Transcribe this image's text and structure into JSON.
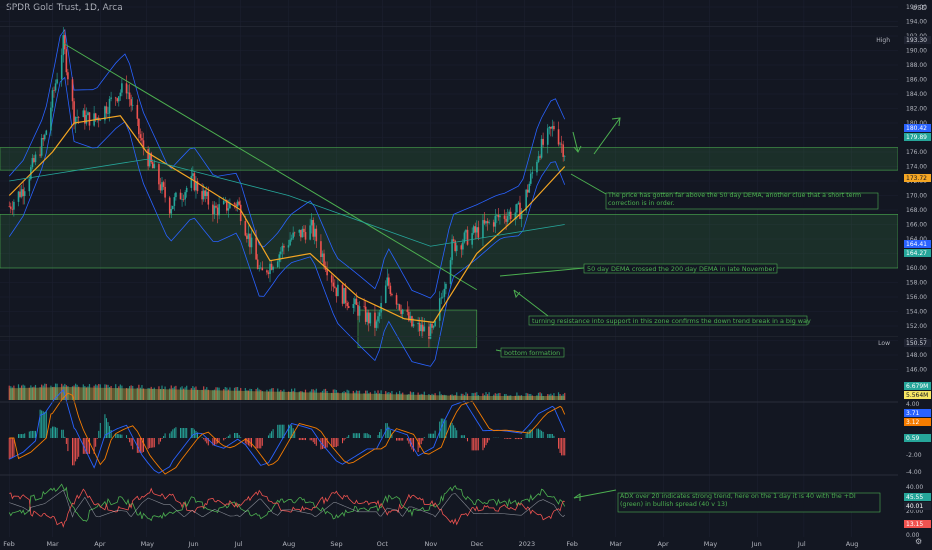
{
  "header": {
    "title": "SPDR Gold Trust, 1D, Arca"
  },
  "axis": {
    "currency": "USD",
    "price_ticks": [
      "196.00",
      "194.00",
      "192.00",
      "190.00",
      "188.00",
      "186.00",
      "184.00",
      "182.00",
      "180.00",
      "178.00",
      "176.00",
      "174.00",
      "172.00",
      "170.00",
      "168.00",
      "166.00",
      "164.00",
      "162.00",
      "160.00",
      "158.00",
      "156.00",
      "154.00",
      "152.00",
      "150.00",
      "148.00",
      "146.00"
    ],
    "macd_ticks": [
      "4.00",
      "2.00",
      "0.00",
      "-2.00",
      "-4.00"
    ],
    "adx_ticks": [
      "40.00",
      "20.00",
      "10.00",
      "0.00"
    ],
    "month_labels": [
      "Feb",
      "Mar",
      "Apr",
      "May",
      "Jun",
      "Jul",
      "Aug",
      "Sep",
      "Oct",
      "Nov",
      "Dec",
      "2023",
      "Feb",
      "Mar",
      "Apr",
      "May",
      "Jun",
      "Jul",
      "Aug"
    ]
  },
  "badges": {
    "high_label": "High",
    "high_value": "193.30",
    "low_label": "Low",
    "low_value": "150.57",
    "price1": "180.42",
    "price2": "179.89",
    "price3": "173.72",
    "price4": "164.41",
    "price5": "164.27",
    "vol1": "6.679M",
    "vol2": "5.564M",
    "macd1": "3.71",
    "macd2": "3.12",
    "macd3": "0.59",
    "adx1": "45.55",
    "adx2": "40.01",
    "adx3": "13.15"
  },
  "annotations": {
    "dema_above": "The price has gotten far above the 50 day DEMA, another clue that a short term correction is in order.",
    "dema_cross": "50 day DEMA crossed the 200 day DEMA in late November",
    "resistance": "turning resistance into support in this zone confirms the down trend break in a big way",
    "bottom": "bottom formation",
    "adx": "ADX over 20 indicates strong trend, here on the 1 day it is 40 with the +DI (green) in bullish spread (40 v 13)"
  },
  "colors": {
    "bg": "#131722",
    "up": "#26a69a",
    "down": "#ef5350",
    "dema50": "#f5a623",
    "bands": "#2962ff",
    "zone": "#4caf50",
    "axis_text": "#b2b5be",
    "vol": "#b5a642"
  },
  "chart_data": {
    "type": "candlestick",
    "title": "SPDR Gold Trust, 1D, Arca",
    "ylim": [
      146,
      196
    ],
    "price_path": [
      [
        "2022-02-01",
        168.5
      ],
      [
        "2022-02-10",
        171
      ],
      [
        "2022-02-24",
        178
      ],
      [
        "2022-03-08",
        191
      ],
      [
        "2022-03-15",
        181
      ],
      [
        "2022-03-29",
        180.5
      ],
      [
        "2022-04-12",
        184
      ],
      [
        "2022-04-18",
        185
      ],
      [
        "2022-04-28",
        177
      ],
      [
        "2022-05-16",
        168.5
      ],
      [
        "2022-05-31",
        172
      ],
      [
        "2022-06-14",
        168
      ],
      [
        "2022-06-29",
        169
      ],
      [
        "2022-07-14",
        159
      ],
      [
        "2022-07-22",
        161
      ],
      [
        "2022-08-02",
        164
      ],
      [
        "2022-08-16",
        165.5
      ],
      [
        "2022-09-01",
        157
      ],
      [
        "2022-09-27",
        152
      ],
      [
        "2022-10-04",
        158
      ],
      [
        "2022-10-20",
        152
      ],
      [
        "2022-11-03",
        151
      ],
      [
        "2022-11-15",
        163
      ],
      [
        "2022-12-01",
        165
      ],
      [
        "2022-12-15",
        167
      ],
      [
        "2022-12-30",
        168
      ],
      [
        "2023-01-10",
        176
      ],
      [
        "2023-01-20",
        179.5
      ],
      [
        "2023-01-27",
        176
      ]
    ],
    "dema50_path": [
      [
        "2022-02-01",
        170
      ],
      [
        "2022-03-01",
        176
      ],
      [
        "2022-03-15",
        180
      ],
      [
        "2022-04-14",
        181
      ],
      [
        "2022-05-01",
        176
      ],
      [
        "2022-06-01",
        172
      ],
      [
        "2022-07-01",
        168
      ],
      [
        "2022-07-20",
        161
      ],
      [
        "2022-08-15",
        162
      ],
      [
        "2022-09-15",
        156
      ],
      [
        "2022-10-15",
        153
      ],
      [
        "2022-11-03",
        152.5
      ],
      [
        "2022-12-01",
        162
      ],
      [
        "2023-01-01",
        168
      ],
      [
        "2023-01-27",
        174
      ]
    ],
    "zones": [
      {
        "from": 173.5,
        "to": 176.6
      },
      {
        "from": 160.0,
        "to": 167.4
      },
      {
        "from": 149.0,
        "to": 154.2,
        "x_from": "2022-09-15",
        "x_to": "2022-12-01"
      }
    ],
    "trendline": {
      "start": [
        "2022-03-08",
        191
      ],
      "end": [
        "2022-12-01",
        157
      ]
    },
    "high": 193.3,
    "low": 150.57
  }
}
